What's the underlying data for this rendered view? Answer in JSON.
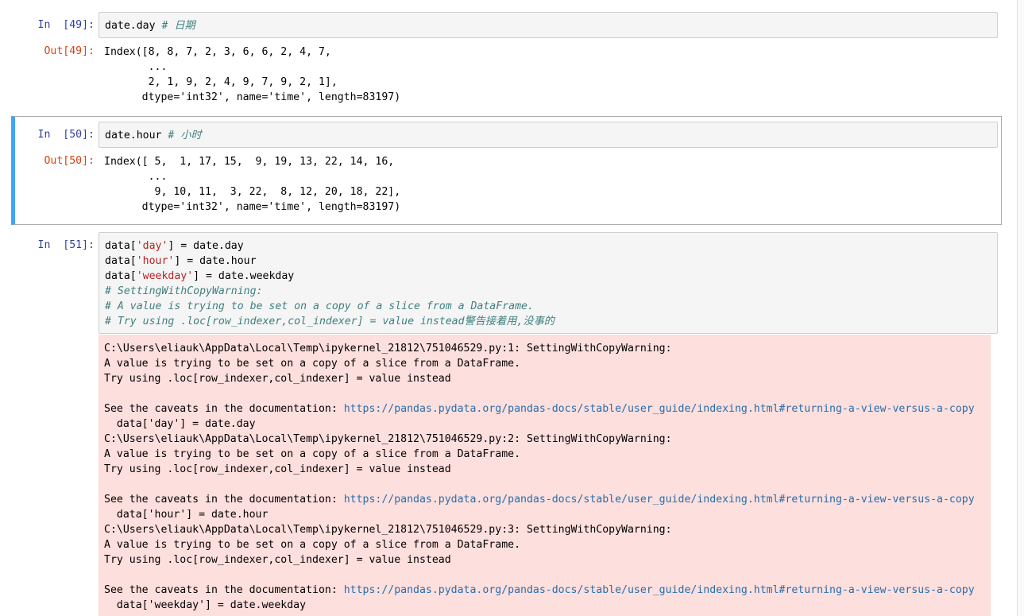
{
  "cells": [
    {
      "in_prompt": "In  [49]:",
      "out_prompt": "Out[49]:",
      "code": {
        "code": "date.day",
        "comment": "# 日期"
      },
      "output": [
        "Index([8, 8, 7, 2, 3, 6, 6, 2, 4, 7,",
        "       ...",
        "       2, 1, 9, 2, 4, 9, 7, 9, 2, 1],",
        "      dtype='int32', name='time', length=83197)"
      ]
    },
    {
      "in_prompt": "In  [50]:",
      "out_prompt": "Out[50]:",
      "code": {
        "code": "date.hour",
        "comment": "# 小时"
      },
      "output": [
        "Index([ 5,  1, 17, 15,  9, 19, 13, 22, 14, 16,",
        "       ...",
        "        9, 10, 11,  3, 22,  8, 12, 20, 18, 22],",
        "      dtype='int32', name='time', length=83197)"
      ]
    },
    {
      "in_prompt": "In  [51]:",
      "code_lines": [
        {
          "pre": "data[",
          "str": "'day'",
          "post": "] = date.day"
        },
        {
          "pre": "data[",
          "str": "'hour'",
          "post": "] = date.hour"
        },
        {
          "pre": "data[",
          "str": "'weekday'",
          "post": "] = date.weekday"
        }
      ],
      "comments": [
        "# SettingWithCopyWarning:",
        "# A value is trying to be set on a copy of a slice from a DataFrame.",
        "# Try using .loc[row_indexer,col_indexer] = value instead警告接着用,没事的"
      ],
      "warnings": [
        {
          "path": "C:\\Users\\eliauk\\AppData\\Local\\Temp\\ipykernel_21812\\751046529.py:1: SettingWithCopyWarning:",
          "line2": "A value is trying to be set on a copy of a slice from a DataFrame.",
          "line3": "Try using .loc[row_indexer,col_indexer] = value instead",
          "see": "See the caveats in the documentation: ",
          "url": "https://pandas.pydata.org/pandas-docs/stable/user_guide/indexing.html#returning-a-view-versus-a-copy",
          "src": "  data['day'] = date.day"
        },
        {
          "path": "C:\\Users\\eliauk\\AppData\\Local\\Temp\\ipykernel_21812\\751046529.py:2: SettingWithCopyWarning:",
          "line2": "A value is trying to be set on a copy of a slice from a DataFrame.",
          "line3": "Try using .loc[row_indexer,col_indexer] = value instead",
          "see": "See the caveats in the documentation: ",
          "url": "https://pandas.pydata.org/pandas-docs/stable/user_guide/indexing.html#returning-a-view-versus-a-copy",
          "src": "  data['hour'] = date.hour"
        },
        {
          "path": "C:\\Users\\eliauk\\AppData\\Local\\Temp\\ipykernel_21812\\751046529.py:3: SettingWithCopyWarning:",
          "line2": "A value is trying to be set on a copy of a slice from a DataFrame.",
          "line3": "Try using .loc[row_indexer,col_indexer] = value instead",
          "see": "See the caveats in the documentation: ",
          "url": "https://pandas.pydata.org/pandas-docs/stable/user_guide/indexing.html#returning-a-view-versus-a-copy",
          "src": "  data['weekday'] = date.weekday"
        }
      ]
    }
  ],
  "colors": {
    "in_prompt": "#303f9f",
    "out_prompt": "#d84315",
    "selected_border": "#42a5f5",
    "stderr_bg": "#fddfdd",
    "comment": "#408080",
    "string": "#ba2121",
    "link": "#296eaa"
  }
}
